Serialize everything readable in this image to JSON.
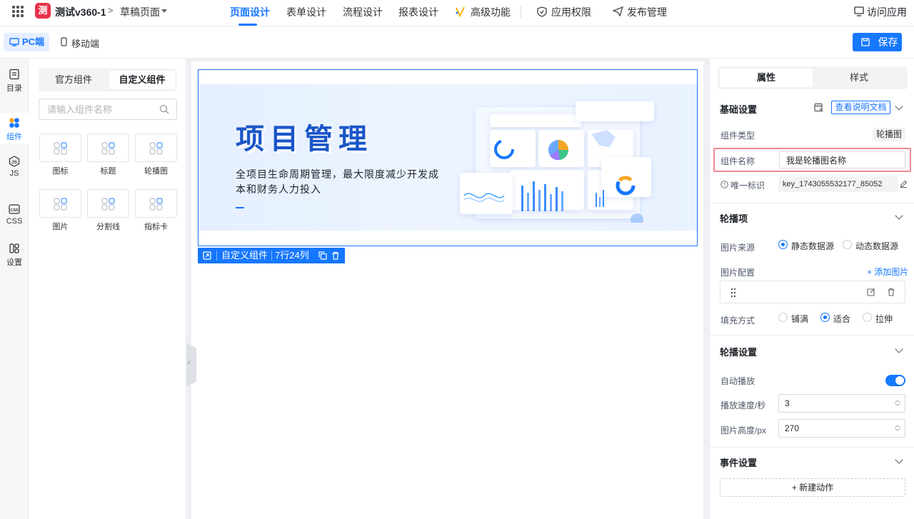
{
  "app": {
    "logo_char": "测",
    "name": "测试v360-1",
    "crumb_sep": ">",
    "page": "草稿页面"
  },
  "nav": {
    "tabs": [
      {
        "label": "页面设计",
        "active": true
      },
      {
        "label": "表单设计"
      },
      {
        "label": "流程设计"
      },
      {
        "label": "报表设计"
      },
      {
        "label": "高级功能"
      },
      {
        "label": "应用权限"
      },
      {
        "label": "发布管理"
      }
    ],
    "visit": "访问应用"
  },
  "device": {
    "pc": "PC端",
    "mobile": "移动端",
    "save": "保存"
  },
  "rail": [
    {
      "label": "目录"
    },
    {
      "label": "组件"
    },
    {
      "label": "JS"
    },
    {
      "label": "CSS"
    },
    {
      "label": "设置"
    }
  ],
  "components": {
    "tabs": [
      "官方组件",
      "自定义组件"
    ],
    "search_placeholder": "请输入组件名称",
    "items": [
      "图标",
      "标题",
      "轮播图",
      "图片",
      "分割线",
      "指标卡"
    ]
  },
  "banner": {
    "title": "项目管理",
    "subtitle": "全项目生命周期管理，最大限度减少开发成本和财务人力投入"
  },
  "selection": {
    "label": "自定义组件",
    "dims": "7行24列"
  },
  "props": {
    "tabs": [
      "属性",
      "样式"
    ],
    "basic": {
      "title": "基础设置",
      "doc_btn": "查看说明文档",
      "type_label": "组件类型",
      "type_value": "轮播图",
      "name_label": "组件名称",
      "name_value": "我是轮播图名称",
      "id_label": "唯一标识",
      "id_value": "key_1743055532177_85052"
    },
    "carousel_items": {
      "title": "轮播项",
      "source_label": "图片来源",
      "source_options": [
        "静态数据源",
        "动态数据源"
      ],
      "config_label": "图片配置",
      "add_image": "+ 添加图片",
      "fill_label": "填充方式",
      "fill_options": [
        "铺满",
        "适合",
        "拉伸"
      ]
    },
    "carousel_settings": {
      "title": "轮播设置",
      "autoplay_label": "自动播放",
      "speed_label": "播放速度/秒",
      "speed_value": "3",
      "height_label": "图片高度/px",
      "height_value": "270"
    },
    "events": {
      "title": "事件设置",
      "new_action": "+ 新建动作"
    }
  },
  "colors": {
    "accent": "#1677ff",
    "highlight": "#f08a92",
    "logo": "#e8334a"
  }
}
